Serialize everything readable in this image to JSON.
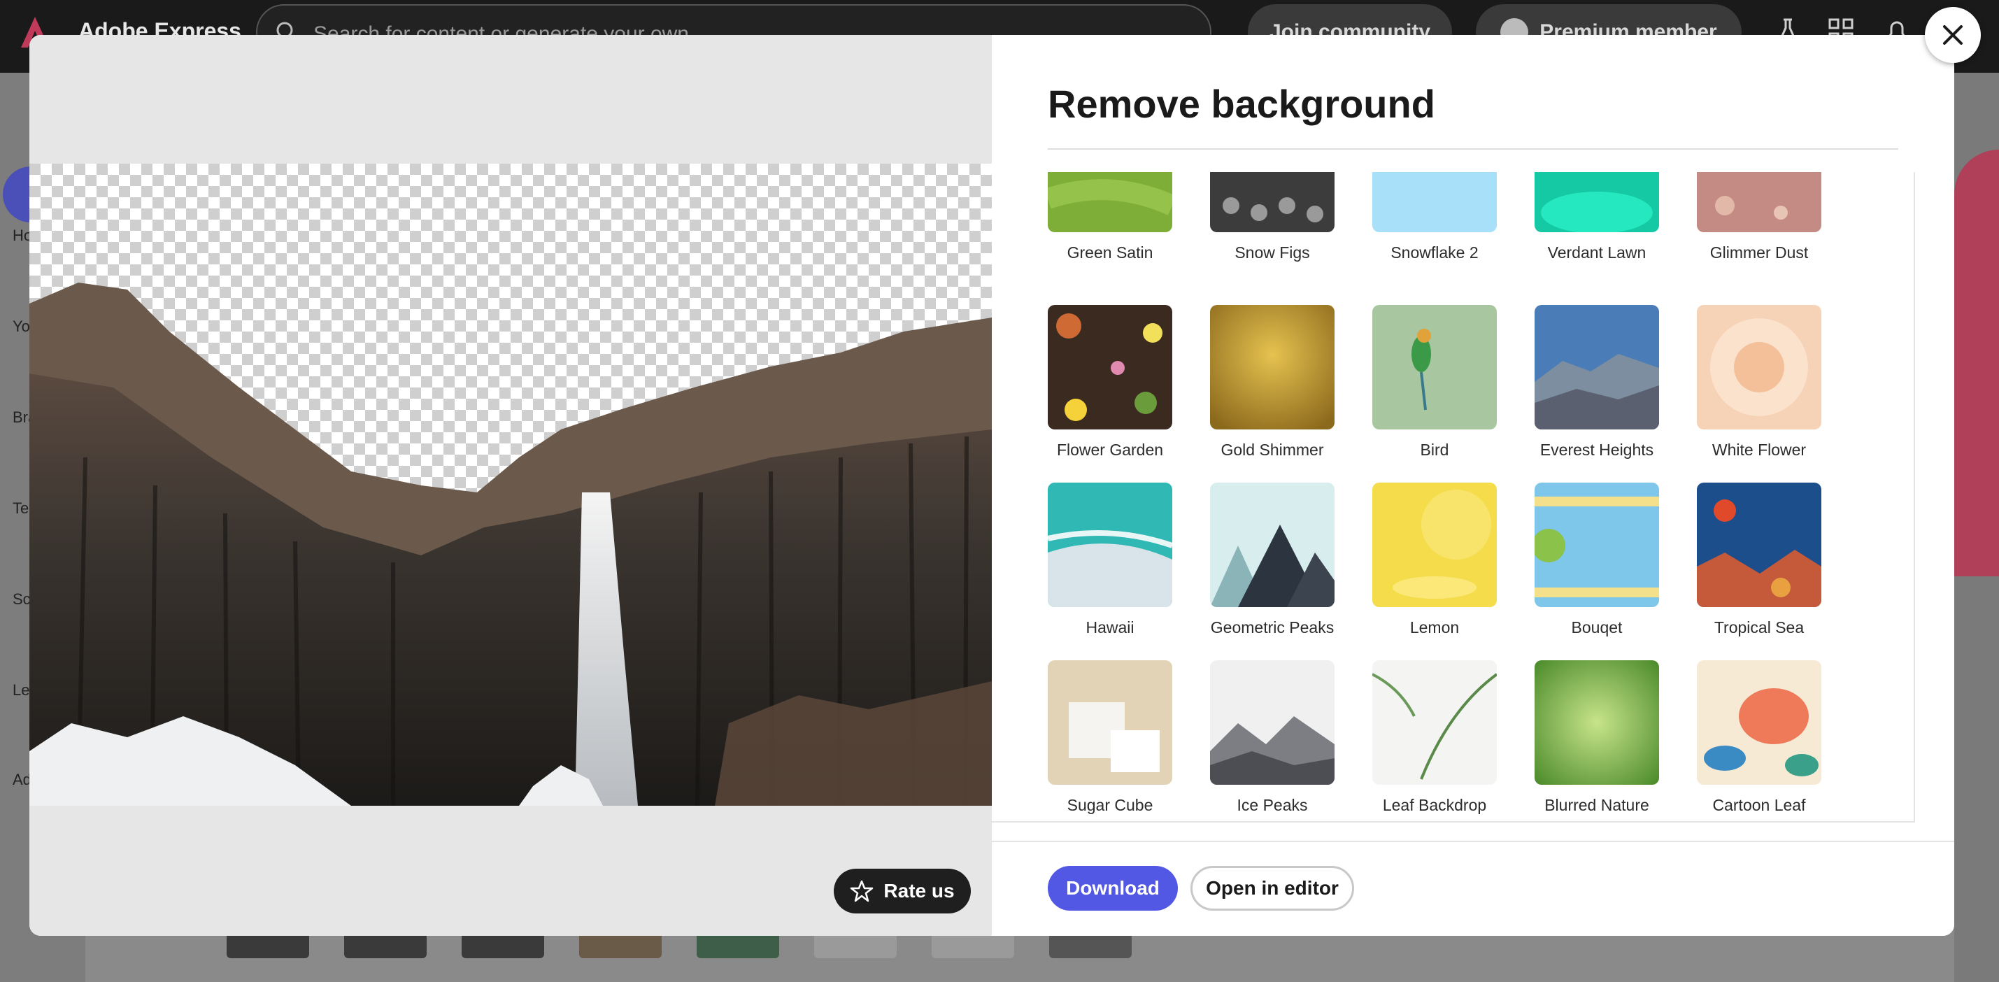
{
  "app": {
    "name": "Adobe Express",
    "search_placeholder": "Search for content or generate your own",
    "join_community": "Join community",
    "premium_member": "Premium member",
    "rail_labels": [
      "Ho",
      "You",
      "Bra",
      "Tem",
      "Sche",
      "Le",
      "Add"
    ]
  },
  "modal": {
    "title": "Remove background",
    "rate_label": "Rate us",
    "download_label": "Download",
    "open_editor_label": "Open in editor"
  },
  "backgrounds": [
    {
      "name": "Green Satin"
    },
    {
      "name": "Snow Figs"
    },
    {
      "name": "Snowflake 2"
    },
    {
      "name": "Verdant Lawn"
    },
    {
      "name": "Glimmer Dust"
    },
    {
      "name": "Flower Garden"
    },
    {
      "name": "Gold Shimmer"
    },
    {
      "name": "Bird"
    },
    {
      "name": "Everest Heights"
    },
    {
      "name": "White Flower"
    },
    {
      "name": "Hawaii"
    },
    {
      "name": "Geometric Peaks"
    },
    {
      "name": "Lemon"
    },
    {
      "name": "Bouqet"
    },
    {
      "name": "Tropical Sea"
    },
    {
      "name": "Sugar Cube"
    },
    {
      "name": "Ice Peaks"
    },
    {
      "name": "Leaf Backdrop"
    },
    {
      "name": "Blurred Nature"
    },
    {
      "name": "Cartoon Leaf"
    }
  ],
  "colors": {
    "accent": "#5258e4",
    "title": "#1a1a1a"
  }
}
